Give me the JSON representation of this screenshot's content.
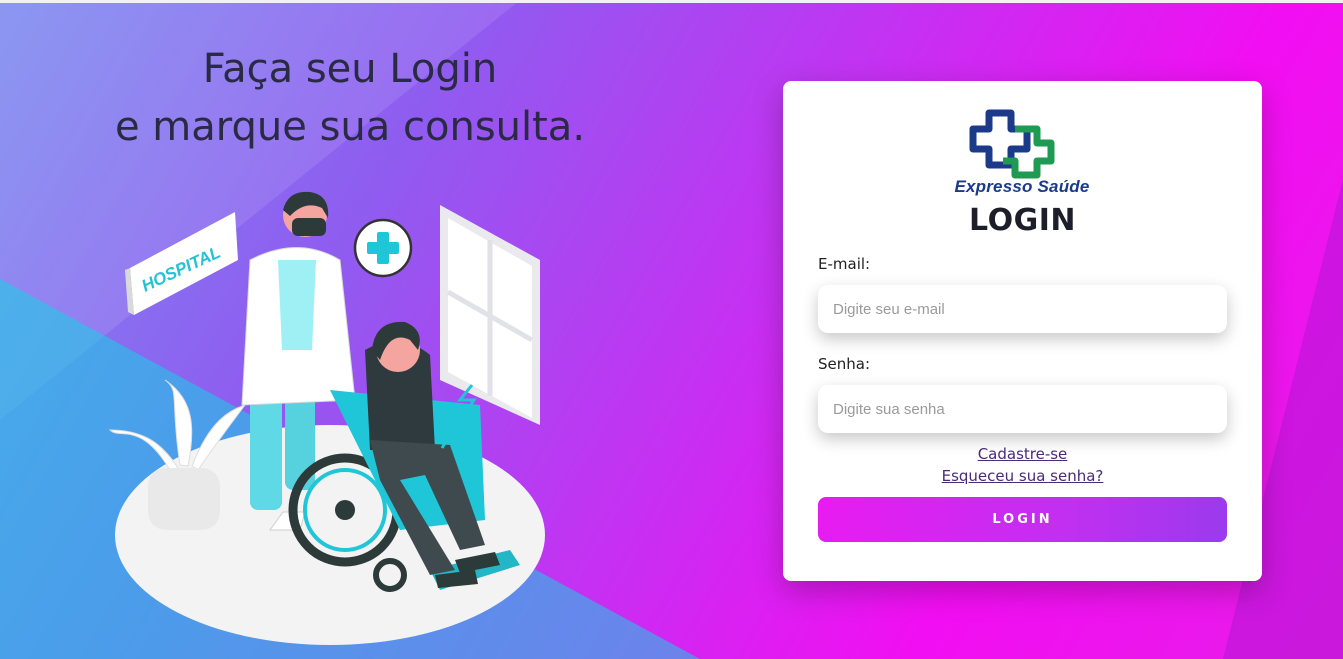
{
  "hero": {
    "line1": "Faça seu Login",
    "line2": "e marque sua consulta."
  },
  "illustration": {
    "sign_text": "HOSPITAL"
  },
  "brand": {
    "name": "Expresso Saúde",
    "logo_icon": "medical-cross-icon",
    "colors": {
      "blue": "#1b3a8a",
      "green": "#1e9a52"
    }
  },
  "login_form": {
    "title": "LOGIN",
    "email_label": "E-mail:",
    "email_placeholder": "Digite seu e-mail",
    "email_value": "",
    "password_label": "Senha:",
    "password_placeholder": "Digite sua senha",
    "password_value": "",
    "signup_link": "Cadastre-se",
    "forgot_link": "Esqueceu sua senha?",
    "submit_label": "LOGIN"
  }
}
